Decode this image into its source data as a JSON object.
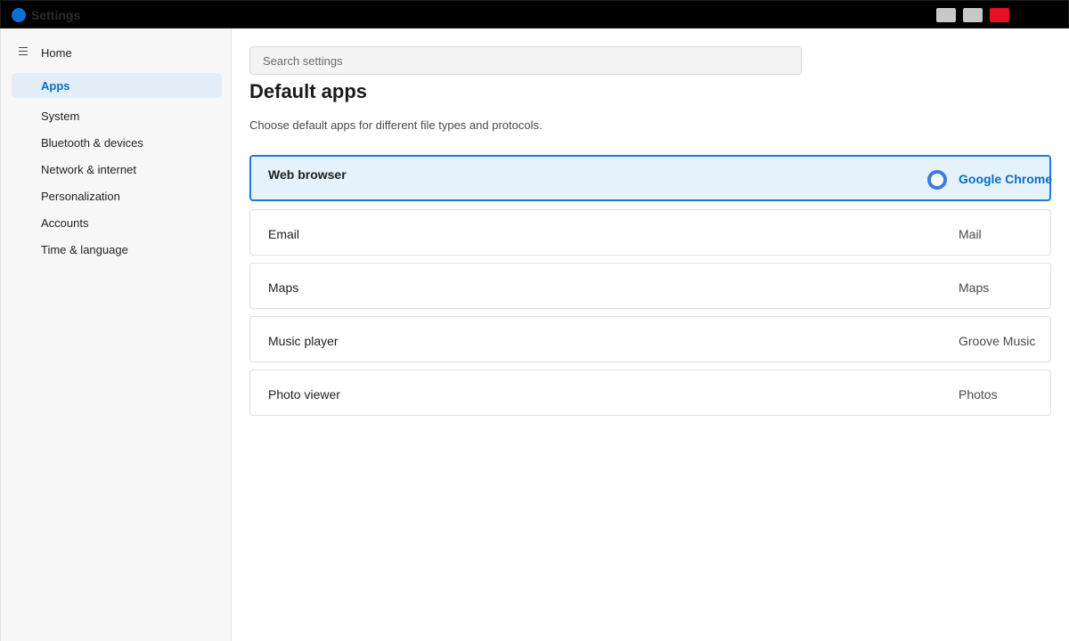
{
  "window": {
    "title": "Settings"
  },
  "sidebar": {
    "home_label": "Home",
    "items": [
      {
        "label": "Apps",
        "active": true
      },
      {
        "label": "System"
      },
      {
        "label": "Bluetooth & devices"
      },
      {
        "label": "Network & internet"
      },
      {
        "label": "Personalization"
      },
      {
        "label": "Accounts"
      },
      {
        "label": "Time & language"
      }
    ]
  },
  "search": {
    "placeholder": "Search settings"
  },
  "main": {
    "title": "Default apps",
    "description": "Choose default apps for different file types and protocols.",
    "rows": [
      {
        "label": "Web browser",
        "value": "Google Chrome",
        "selected": true
      },
      {
        "label": "Email",
        "value": "Mail"
      },
      {
        "label": "Maps",
        "value": "Maps"
      },
      {
        "label": "Music player",
        "value": "Groove Music"
      },
      {
        "label": "Photo viewer",
        "value": "Photos"
      }
    ]
  },
  "colors": {
    "accent": "#0a6fc2",
    "close": "#e81123",
    "selected_bg": "#e5f1fb"
  },
  "icons": [
    "app-logo-icon",
    "menu-icon",
    "radio-icon"
  ]
}
